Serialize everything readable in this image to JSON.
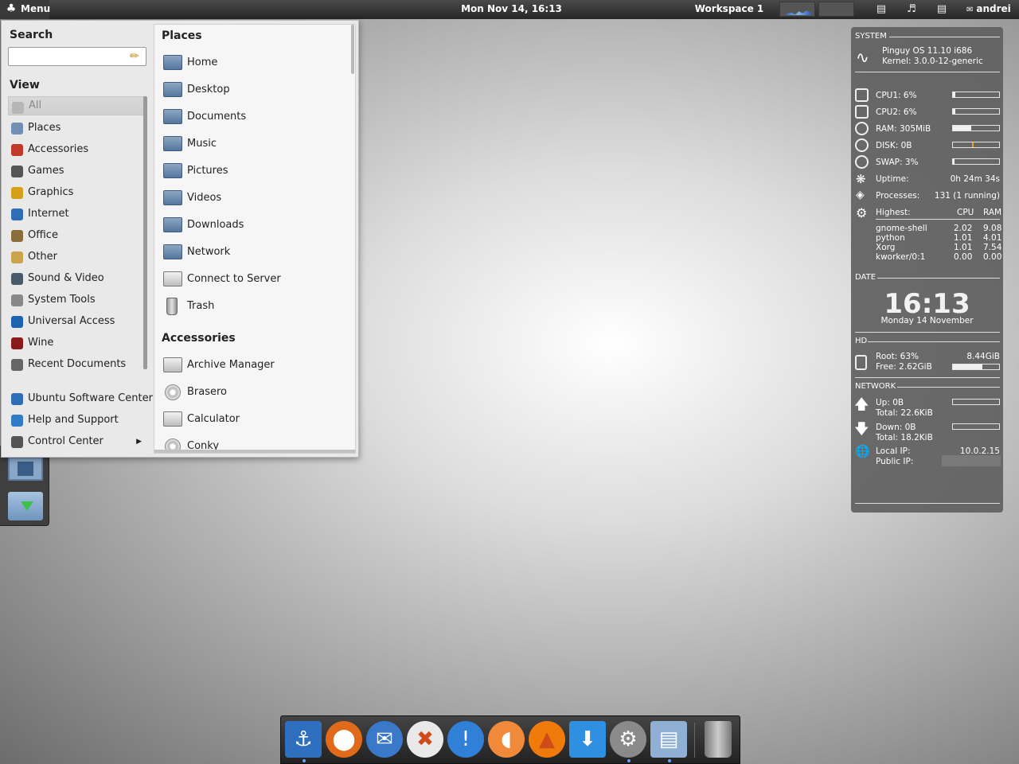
{
  "top_panel": {
    "menu_label": "Menu",
    "clock": "Mon Nov 14, 16:13",
    "workspace": "Workspace 1",
    "user": "andrei"
  },
  "menu": {
    "search_title": "Search",
    "search_value": "",
    "view_title": "View",
    "view_items": [
      {
        "label": "All",
        "icon": "all-icon"
      },
      {
        "label": "Places",
        "icon": "folder-icon"
      },
      {
        "label": "Accessories",
        "icon": "accessories-icon"
      },
      {
        "label": "Games",
        "icon": "games-icon"
      },
      {
        "label": "Graphics",
        "icon": "graphics-icon"
      },
      {
        "label": "Internet",
        "icon": "globe-icon"
      },
      {
        "label": "Office",
        "icon": "office-icon"
      },
      {
        "label": "Other",
        "icon": "other-icon"
      },
      {
        "label": "Sound & Video",
        "icon": "multimedia-icon"
      },
      {
        "label": "System Tools",
        "icon": "system-icon"
      },
      {
        "label": "Universal Access",
        "icon": "accessibility-icon"
      },
      {
        "label": "Wine",
        "icon": "wine-icon"
      },
      {
        "label": "Recent Documents",
        "icon": "recent-icon"
      }
    ],
    "bottom_items": [
      {
        "label": "Ubuntu Software Center",
        "icon": "software-center-icon"
      },
      {
        "label": "Help and Support",
        "icon": "help-icon"
      },
      {
        "label": "Control Center",
        "icon": "control-center-icon"
      }
    ],
    "places_title": "Places",
    "places": [
      {
        "label": "Home",
        "icon": "home-folder-icon"
      },
      {
        "label": "Desktop",
        "icon": "desktop-icon"
      },
      {
        "label": "Documents",
        "icon": "documents-folder-icon"
      },
      {
        "label": "Music",
        "icon": "music-folder-icon"
      },
      {
        "label": "Pictures",
        "icon": "pictures-folder-icon"
      },
      {
        "label": "Videos",
        "icon": "videos-folder-icon"
      },
      {
        "label": "Downloads",
        "icon": "downloads-folder-icon"
      },
      {
        "label": "Network",
        "icon": "network-icon"
      },
      {
        "label": "Connect to Server",
        "icon": "server-icon"
      },
      {
        "label": "Trash",
        "icon": "trash-icon"
      }
    ],
    "accessories_title": "Accessories",
    "accessories": [
      {
        "label": "Archive Manager",
        "icon": "archive-icon"
      },
      {
        "label": "Brasero",
        "icon": "disc-icon"
      },
      {
        "label": "Calculator",
        "icon": "calculator-icon"
      },
      {
        "label": "Conky",
        "icon": "conky-icon"
      }
    ]
  },
  "conky": {
    "system_header": "SYSTEM",
    "os": "Pinguy OS 11.10 i686",
    "kernel": "Kernel: 3.0.0-12-generic",
    "cpu1": "CPU1: 6%",
    "cpu1_level": 0.06,
    "cpu2": "CPU2: 6%",
    "cpu2_level": 0.06,
    "ram": "RAM: 305MiB",
    "ram_level": 0.4,
    "disk": "DISK: 0B",
    "disk_level": 0.45,
    "swap": "SWAP: 3%",
    "swap_level": 0.03,
    "uptime_label": "Uptime:",
    "uptime_value": "0h 24m 34s",
    "processes_label": "Processes:",
    "processes_value": "131 (1 running)",
    "highest_label": "Highest:",
    "cpu_col": "CPU",
    "ram_col": "RAM",
    "top_processes": [
      {
        "name": "gnome-shell",
        "cpu": "2.02",
        "ram": "9.08"
      },
      {
        "name": "python",
        "cpu": "1.01",
        "ram": "4.01"
      },
      {
        "name": "Xorg",
        "cpu": "1.01",
        "ram": "7.54"
      },
      {
        "name": "kworker/0:1",
        "cpu": "0.00",
        "ram": "0.00"
      }
    ],
    "date_header": "DATE",
    "time": "16:13",
    "date": "Monday 14 November",
    "hd_header": "HD",
    "root": "Root: 63%",
    "root_size": "8.44GiB",
    "free": "Free: 2.62GiB",
    "root_level": 0.63,
    "network_header": "NETWORK",
    "up": "Up: 0B",
    "up_total": "Total: 22.6KiB",
    "up_level": 0,
    "down": "Down: 0B",
    "down_total": "Total: 18.2KiB",
    "down_level": 0,
    "local_ip_label": "Local IP:",
    "local_ip": "10.0.2.15",
    "public_ip_label": "Public IP:"
  },
  "dock_items": [
    {
      "icon": "anchor-icon",
      "name": "dock-anchor"
    },
    {
      "icon": "firefox-icon",
      "name": "dock-firefox"
    },
    {
      "icon": "thunderbird-icon",
      "name": "dock-thunderbird"
    },
    {
      "icon": "chat-icon",
      "name": "dock-xchat"
    },
    {
      "icon": "notification-icon",
      "name": "dock-notify"
    },
    {
      "icon": "orange-icon",
      "name": "dock-clementine"
    },
    {
      "icon": "vlc-icon",
      "name": "dock-vlc"
    },
    {
      "icon": "download-icon",
      "name": "dock-downloader"
    },
    {
      "icon": "gear-icon",
      "name": "dock-settings"
    },
    {
      "icon": "folder-icon",
      "name": "dock-files"
    },
    {
      "icon": "trash-icon",
      "name": "dock-trash"
    }
  ]
}
